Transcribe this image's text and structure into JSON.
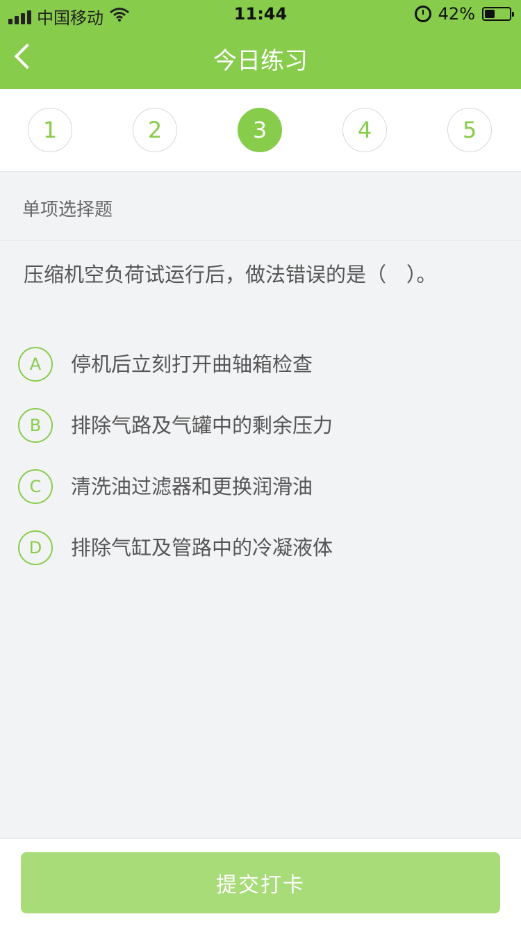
{
  "status_bar": {
    "carrier": "中国移动",
    "time": "11:44",
    "battery": "42%",
    "battery_level": 0.42,
    "signal_icon": "signal-icon",
    "wifi_icon": "wifi-icon",
    "alarm_icon": "alarm-icon",
    "battery_icon": "battery-icon"
  },
  "header": {
    "title": "今日练习",
    "back_icon": "back-arrow-icon"
  },
  "numbers": [
    "1",
    "2",
    "3",
    "4",
    "5"
  ],
  "current_number": "3",
  "question": {
    "type": "单项选择题",
    "text": "压缩机空负荷试运行后，做法错误的是（　）。",
    "options": [
      {
        "label": "A",
        "text": "停机后立刻打开曲轴箱检查"
      },
      {
        "label": "B",
        "text": "排除气路及气罐中的剩余压力"
      },
      {
        "label": "C",
        "text": "清洗油过滤器和更换润滑油"
      },
      {
        "label": "D",
        "text": "排除气缸及管路中的冷凝液体"
      }
    ]
  },
  "footer": {
    "submit_label": "提交打卡"
  },
  "colors": {
    "accent": "#87cc4b",
    "submit_disabled": "#a8dc78",
    "background": "#f2f3f5"
  }
}
